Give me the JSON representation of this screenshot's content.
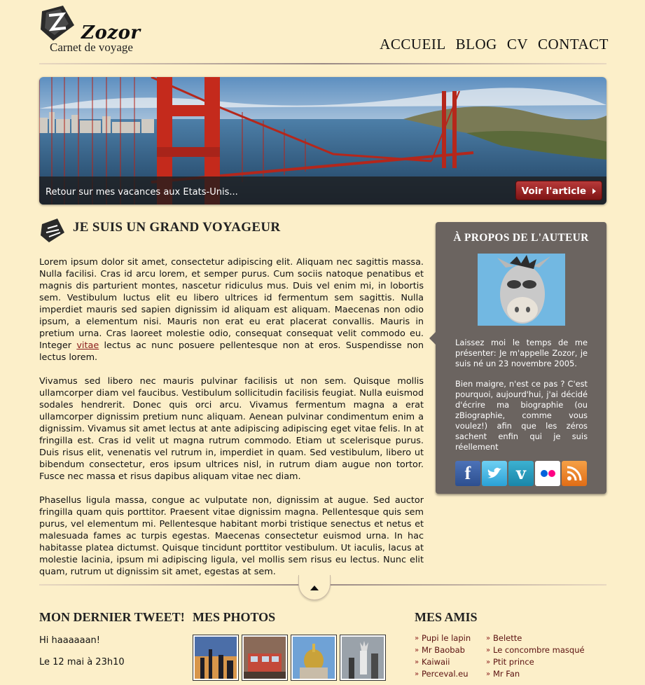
{
  "header": {
    "logo_title": "Zozor",
    "logo_subtitle": "Carnet de voyage",
    "nav": [
      "ACCUEIL",
      "BLOG",
      "CV",
      "CONTACT"
    ]
  },
  "banner": {
    "caption": "Retour sur mes vacances aux Etats-Unis...",
    "button_label": "Voir l'article"
  },
  "article": {
    "title": "JE SUIS UN GRAND VOYAGEUR",
    "p1_before_link": "Lorem ipsum dolor sit amet, consectetur adipiscing elit. Aliquam nec sagittis massa. Nulla facilisi. Cras id arcu lorem, et semper purus. Cum sociis natoque penatibus et magnis dis parturient montes, nascetur ridiculus mus. Duis vel enim mi, in lobortis sem. Vestibulum luctus elit eu libero ultrices id fermentum sem sagittis. Nulla imperdiet mauris sed sapien dignissim id aliquam est aliquam. Maecenas non odio ipsum, a elementum nisi. Mauris non erat eu erat placerat convallis. Mauris in pretium urna. Cras laoreet molestie odio, consequat consequat velit commodo eu. Integer ",
    "p1_link": "vitae",
    "p1_after_link": " lectus ac nunc posuere pellentesque non at eros. Suspendisse non lectus lorem.",
    "p2": "Vivamus sed libero nec mauris pulvinar facilisis ut non sem. Quisque mollis ullamcorper diam vel faucibus. Vestibulum sollicitudin facilisis feugiat. Nulla euismod sodales hendrerit. Donec quis orci arcu. Vivamus fermentum magna a erat ullamcorper dignissim pretium nunc aliquam. Aenean pulvinar condimentum enim a dignissim. Vivamus sit amet lectus at ante adipiscing adipiscing eget vitae felis. In at fringilla est. Cras id velit ut magna rutrum commodo. Etiam ut scelerisque purus. Duis risus elit, venenatis vel rutrum in, imperdiet in quam. Sed vestibulum, libero ut bibendum consectetur, eros ipsum ultrices nisl, in rutrum diam augue non tortor. Fusce nec massa et risus dapibus aliquam vitae nec diam.",
    "p3": "Phasellus ligula massa, congue ac vulputate non, dignissim at augue. Sed auctor fringilla quam quis porttitor. Praesent vitae dignissim magna. Pellentesque quis sem purus, vel elementum mi. Pellentesque habitant morbi tristique senectus et netus et malesuada fames ac turpis egestas. Maecenas consectetur euismod urna. In hac habitasse platea dictumst. Quisque tincidunt porttitor vestibulum. Ut iaculis, lacus at molestie lacinia, ipsum mi adipiscing ligula, vel mollis sem risus eu lectus. Nunc elit quam, rutrum ut dignissim sit amet, egestas at sem."
  },
  "aside": {
    "title": "À PROPOS DE L'AUTEUR",
    "text1": "Laissez moi le temps de me présenter: Je m'appelle Zozor, je suis né un 23 novembre 2005.",
    "text2": "Bien maigre, n'est ce pas ? C'est pourquoi, aujourd'hui, j'ai décidé d'écrire ma biographie (ou zBiographie, comme vous voulez!) afin que les zéros sachent enfin qui je suis réellement",
    "socials": [
      "facebook-icon",
      "twitter-icon",
      "vimeo-icon",
      "flickr-icon",
      "rss-icon"
    ]
  },
  "footer": {
    "tweet_title": "MON DERNIER TWEET!",
    "tweet_text": "Hi haaaaaan!",
    "tweet_date": "Le 12 mai à 23h10",
    "photos_title": "MES PHOTOS",
    "friends_title": "MES AMIS",
    "friends_col1": [
      "Pupi le lapin",
      "Mr Baobab",
      "Kaiwaii",
      "Perceval.eu"
    ],
    "friends_col2": [
      "Belette",
      "Le concombre masqué",
      "Ptit prince",
      "Mr Fan"
    ]
  },
  "colors": {
    "background": "#fcefc9",
    "sidebar": "#6b6460",
    "accent": "#8a1c1c"
  }
}
